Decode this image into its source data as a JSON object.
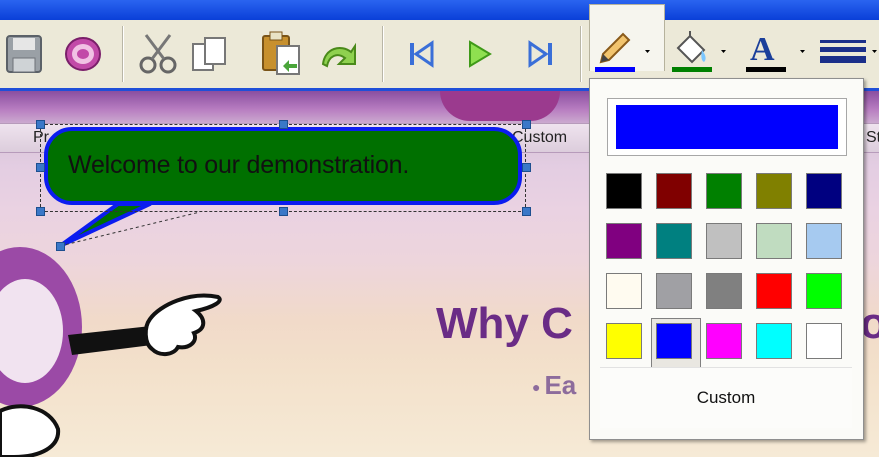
{
  "toolbar": {
    "buttons": [
      "save-icon",
      "spiral-icon",
      "cut-icon",
      "copy-icon",
      "paste-icon",
      "undo-icon",
      "first-frame-icon",
      "play-icon",
      "last-frame-icon",
      "line-color-icon",
      "fill-color-icon",
      "font-color-icon",
      "line-style-icon"
    ],
    "line_color": "#0000ff",
    "fill_color": "#008000",
    "font_color": "#000000"
  },
  "canvas": {
    "tab_labels": [
      "Pr",
      "Custom",
      "St"
    ],
    "callout_text": "Welcome to our demonstration.",
    "callout_fill": "#007000",
    "callout_border": "#0b1cf0",
    "heading_partial": "Why C",
    "heading_tail": "o",
    "subheading_partial": "Ea"
  },
  "color_picker": {
    "current_color": "#0000ff",
    "selected_index": 16,
    "swatches": [
      "#000000",
      "#800000",
      "#008000",
      "#808000",
      "#000080",
      "#800080",
      "#008080",
      "#c0c0c0",
      "#c0dcc0",
      "#a6caf0",
      "#fffbf0",
      "#a0a0a4",
      "#808080",
      "#ff0000",
      "#00ff00",
      "#ffff00",
      "#0000ff",
      "#ff00ff",
      "#00ffff",
      "#ffffff"
    ],
    "custom_label": "Custom"
  }
}
